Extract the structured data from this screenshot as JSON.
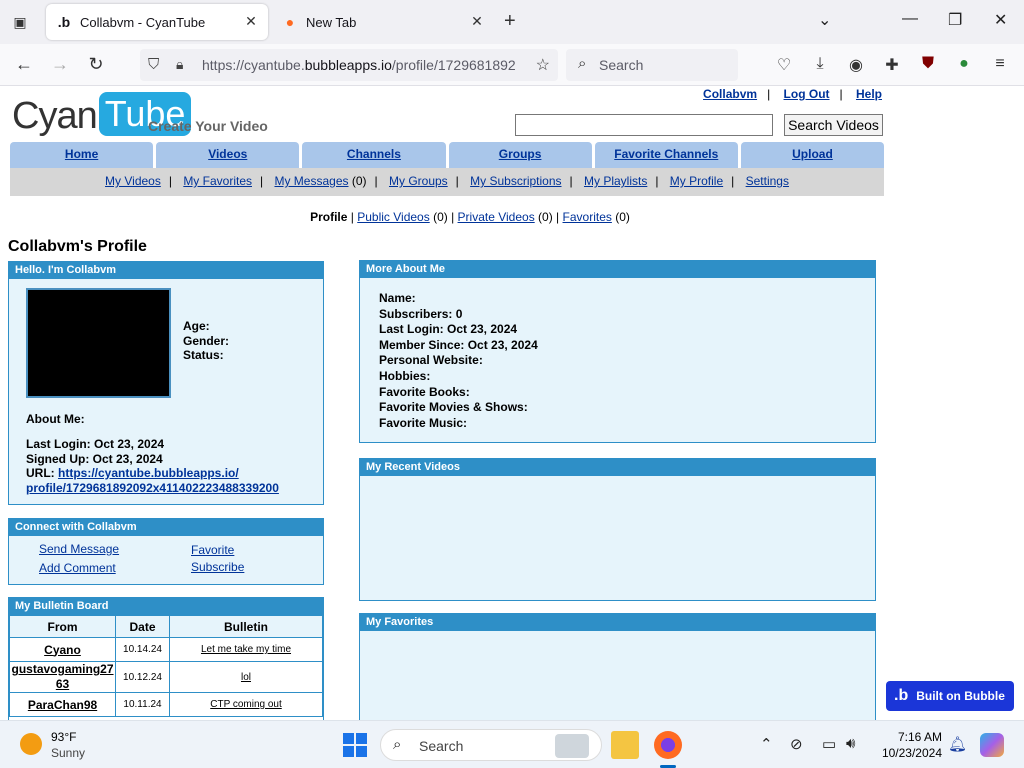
{
  "browser": {
    "tabs": [
      {
        "title": "Collabvm - CyanTube",
        "favicon": "bubble-b"
      },
      {
        "title": "New Tab",
        "favicon": "firefox"
      }
    ],
    "url_prefix": "https://cyantube.",
    "url_domain": "bubbleapps.io",
    "url_suffix": "/profile/1729681892",
    "search_placeholder": "Search"
  },
  "site": {
    "logo_left": "Cyan",
    "logo_right": "Tube",
    "tagline": "Create Your Video",
    "top_links": [
      "Collabvm",
      "Log Out",
      "Help"
    ],
    "search_button": "Search Videos",
    "main_nav": [
      "Home",
      "Videos",
      "Channels",
      "Groups",
      "Favorite Channels",
      "Upload"
    ],
    "sub_nav": [
      {
        "label": "My Videos"
      },
      {
        "label": "My Favorites"
      },
      {
        "label": "My Messages",
        "count": "(0)"
      },
      {
        "label": "My Groups"
      },
      {
        "label": "My Subscriptions"
      },
      {
        "label": "My Playlists"
      },
      {
        "label": "My Profile"
      },
      {
        "label": "Settings"
      }
    ],
    "profile_tabs": {
      "current": "Profile",
      "public_videos": "Public Videos",
      "public_count": "(0)",
      "private_videos": "Private Videos",
      "private_count": "(0)",
      "favorites": "Favorites",
      "favorites_count": "(0)"
    }
  },
  "profile": {
    "title": "Collabvm's Profile",
    "hello_header": "Hello. I'm Collabvm",
    "age_label": "Age:",
    "gender_label": "Gender:",
    "status_label": "Status:",
    "about_label": "About Me:",
    "last_login": "Last Login: Oct 23, 2024",
    "signed_up": "Signed Up: Oct 23, 2024",
    "url_label": "URL:",
    "url_line1": "https://cyantube.bubbleapps.io/",
    "url_line2": "profile/1729681892092x411402223488339200",
    "connect_header": "Connect with Collabvm",
    "connect_links": {
      "send_message": "Send Message",
      "favorite": "Favorite",
      "add_comment": "Add Comment",
      "subscribe": "Subscribe"
    },
    "bulletin_header": "My Bulletin Board",
    "bulletin_columns": [
      "From",
      "Date",
      "Bulletin"
    ],
    "bulletin_rows": [
      {
        "from": "Cyano",
        "date": "10.14.24",
        "msg": "Let me take my time"
      },
      {
        "from": "gustavogaming2763",
        "date": "10.12.24",
        "msg": "lol"
      },
      {
        "from": "ParaChan98",
        "date": "10.11.24",
        "msg": "CTP coming out"
      }
    ],
    "more_header": "More About Me",
    "more_fields": [
      "Name:",
      "Subscribers: 0",
      "Last Login: Oct 23, 2024",
      "Member Since: Oct 23, 2024",
      "Personal Website:",
      "Hobbies:",
      "Favorite Books:",
      "Favorite Movies & Shows:",
      "Favorite Music:"
    ],
    "recent_header": "My Recent Videos",
    "favorites_header": "My Favorites"
  },
  "badge": {
    "label": "Built on Bubble"
  },
  "taskbar": {
    "temp": "93°F",
    "weather": "Sunny",
    "search_placeholder": "Search",
    "time": "7:16 AM",
    "date": "10/23/2024"
  },
  "colors": {
    "header_blue": "#2e8fc7",
    "panel_bg": "#e6f4fb",
    "nav_blue": "#a9c6ea",
    "link": "#003399",
    "badge": "#1b36d8"
  }
}
